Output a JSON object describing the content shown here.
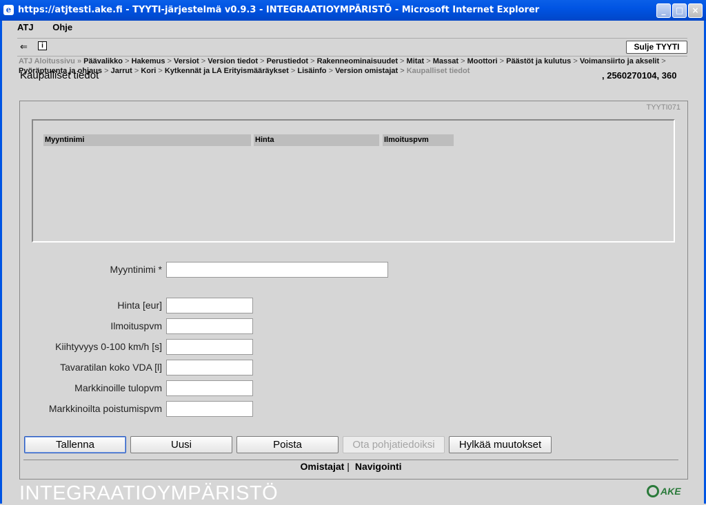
{
  "window": {
    "title": "https://atjtesti.ake.fi - TYYTI-järjestelmä v0.9.3 - INTEGRAATIOYMPÄRISTÖ - Microsoft Internet Explorer"
  },
  "menu": {
    "items": [
      "ATJ",
      "Ohje"
    ]
  },
  "toolbar": {
    "close_label": "Sulje TYYTI"
  },
  "breadcrumb": {
    "root": "ATJ Aloitussivu",
    "items": [
      "Päävalikko",
      "Hakemus",
      "Versiot",
      "Version tiedot",
      "Perustiedot",
      "Rakenneominaisuudet",
      "Mitat",
      "Massat",
      "Moottori",
      "Päästöt ja kulutus",
      "Voimansiirto ja akselit",
      "Pyöräptuenta ja ohjaus",
      "Jarrut",
      "Kori",
      "Kytkennät ja LA Erityismääräykset",
      "Lisäinfo",
      "Version omistajat"
    ],
    "current": "Kaupalliset tiedot"
  },
  "page": {
    "title": "Kaupalliset tiedot",
    "record_id": ", 2560270104, 360",
    "screen_code": "TYYTI071"
  },
  "grid": {
    "columns": [
      "Myyntinimi",
      "Hinta",
      "Ilmoituspvm"
    ]
  },
  "form": {
    "fields": [
      {
        "label": "Myyntinimi *",
        "value": ""
      },
      {
        "label": "Hinta [eur]",
        "value": ""
      },
      {
        "label": "Ilmoituspvm",
        "value": ""
      },
      {
        "label": "Kiihtyvyys 0-100 km/h [s]",
        "value": ""
      },
      {
        "label": "Tavaratilan koko VDA [l]",
        "value": ""
      },
      {
        "label": "Markkinoille tulopvm",
        "value": ""
      },
      {
        "label": "Markkinoilta poistumispvm",
        "value": ""
      }
    ]
  },
  "buttons": {
    "save": "Tallenna",
    "new": "Uusi",
    "delete": "Poista",
    "use_base": "Ota pohjatiedoiksi",
    "discard": "Hylkää muutokset"
  },
  "bottom_links": {
    "owners": "Omistajat",
    "navigation": "Navigointi"
  },
  "environment_banner": "INTEGRAATIOYMPÄRISTÖ",
  "logo_text": "AKE",
  "colors": {
    "titlebar": "#0054e3",
    "background": "#d6d6d6",
    "logo": "#2a7a3a"
  }
}
